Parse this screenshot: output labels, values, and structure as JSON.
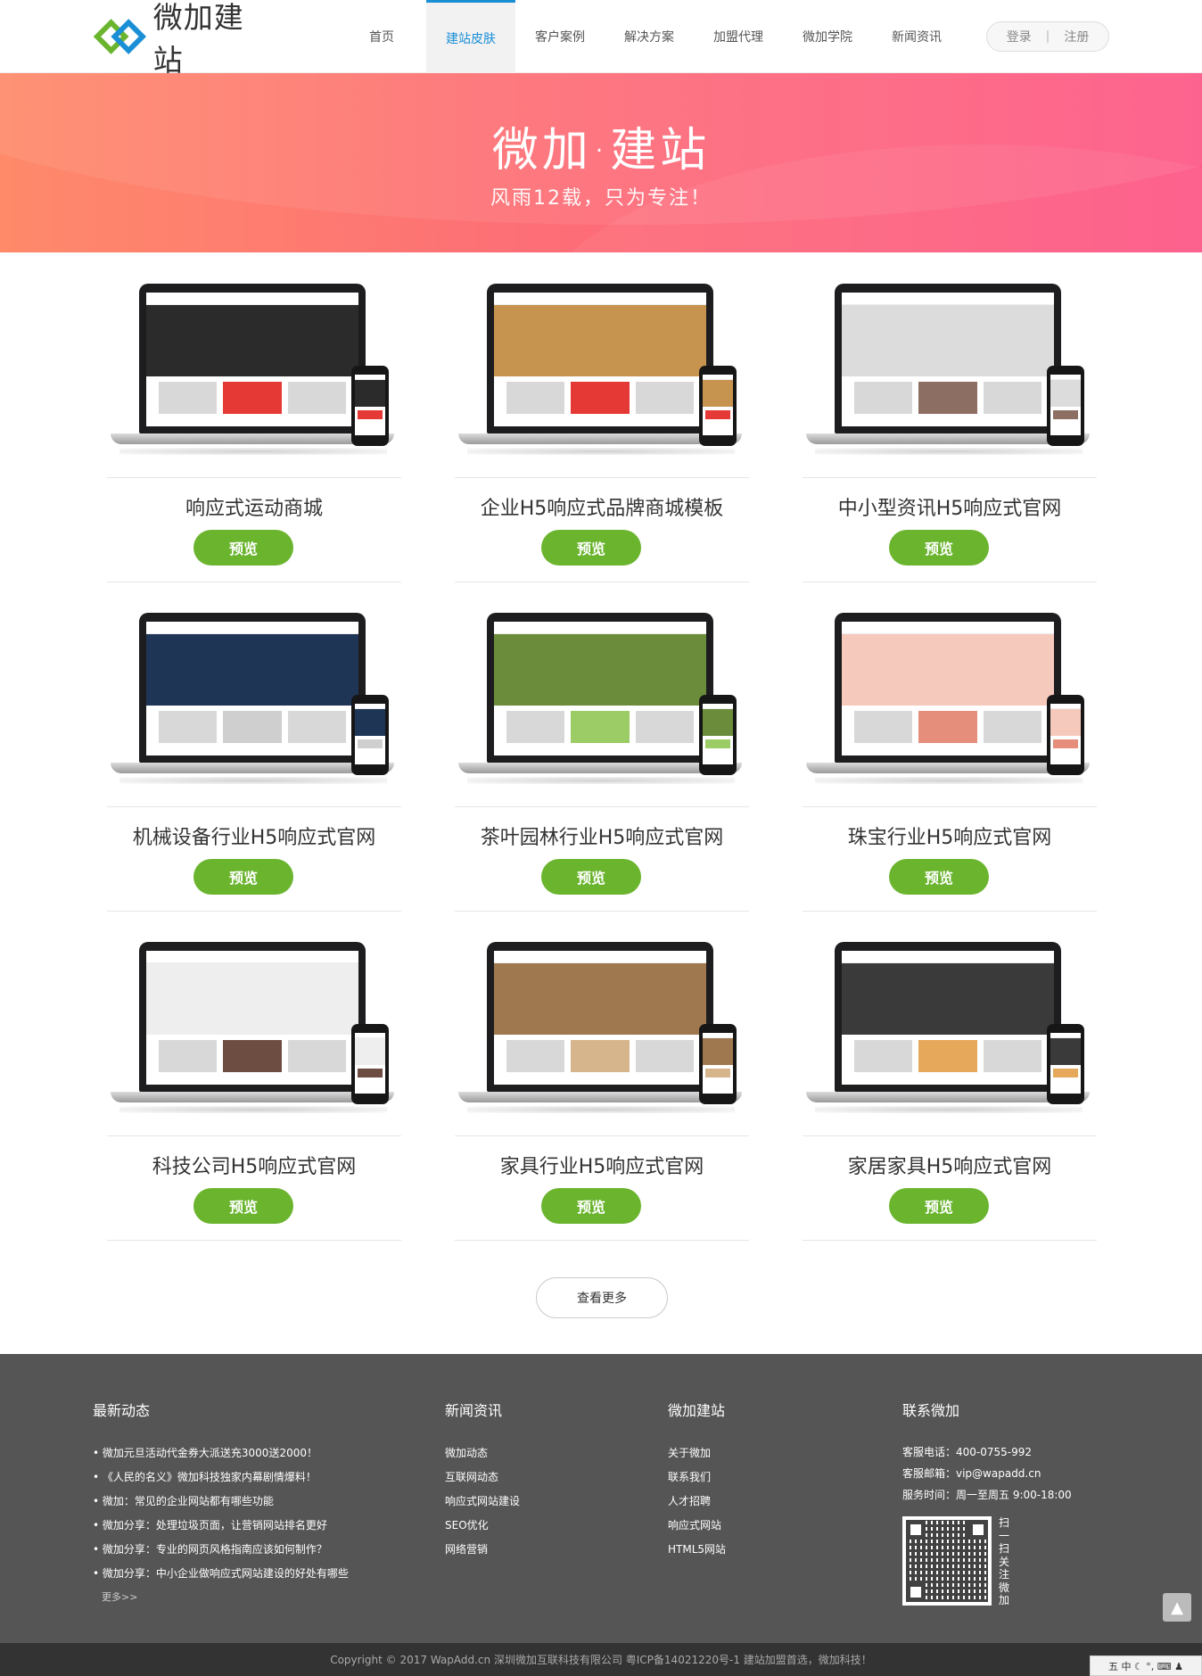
{
  "header": {
    "logo_text": "微加建站",
    "nav": [
      {
        "label": "首页"
      },
      {
        "label": "建站皮肤",
        "active": true
      },
      {
        "label": "客户案例"
      },
      {
        "label": "解决方案"
      },
      {
        "label": "加盟代理"
      },
      {
        "label": "微加学院"
      },
      {
        "label": "新闻资讯"
      }
    ],
    "login": "登录",
    "separator": "|",
    "register": "注册"
  },
  "banner": {
    "title": "微加·建站",
    "subtitle": "风雨12载，只为专注！"
  },
  "templates": [
    {
      "title": "响应式运动商城",
      "button": "预览",
      "theme": "#2b2b2b",
      "accent": "#e53935"
    },
    {
      "title": "企业H5响应式品牌商城模板",
      "button": "预览",
      "theme": "#c79450",
      "accent": "#e53935"
    },
    {
      "title": "中小型资讯H5响应式官网",
      "button": "预览",
      "theme": "#dcdcdc",
      "accent": "#8d6e63"
    },
    {
      "title": "机械设备行业H5响应式官网",
      "button": "预览",
      "theme": "#1f3556",
      "accent": "#cfcfcf"
    },
    {
      "title": "茶叶园林行业H5响应式官网",
      "button": "预览",
      "theme": "#6b8c3a",
      "accent": "#9ccc65"
    },
    {
      "title": "珠宝行业H5响应式官网",
      "button": "预览",
      "theme": "#f6c9bd",
      "accent": "#e58e7c"
    },
    {
      "title": "科技公司H5响应式官网",
      "button": "预览",
      "theme": "#eeeeee",
      "accent": "#6d4c41"
    },
    {
      "title": "家具行业H5响应式官网",
      "button": "预览",
      "theme": "#a07850",
      "accent": "#d7b58c"
    },
    {
      "title": "家居家具H5响应式官网",
      "button": "预览",
      "theme": "#3a3a3a",
      "accent": "#e6a85a"
    }
  ],
  "more_button": "查看更多",
  "footer": {
    "news": {
      "heading": "最新动态",
      "items": [
        "微加元旦活动代金券大派送充3000送2000！",
        "《人民的名义》微加科技独家内幕剧情爆料！",
        "微加：常见的企业网站都有哪些功能",
        "微加分享：处理垃圾页面，让营销网站排名更好",
        "微加分享：专业的网页风格指南应该如何制作？",
        "微加分享：中小企业做响应式网站建设的好处有哪些"
      ],
      "more": "更多>>"
    },
    "info": {
      "heading": "新闻资讯",
      "items": [
        "微加动态",
        "互联网动态",
        "响应式网站建设",
        "SEO优化",
        "网络营销"
      ]
    },
    "site": {
      "heading": "微加建站",
      "items": [
        "关于微加",
        "联系我们",
        "人才招聘",
        "响应式网站",
        "HTML5网站"
      ]
    },
    "contact": {
      "heading": "联系微加",
      "phone": "客服电话：400-0755-992",
      "email": "客服邮箱：vip@wapadd.cn",
      "hours": "服务时间：周一至周五 9:00-18:00",
      "qr_caption": "扫一扫关注微加"
    }
  },
  "copyright": "Copyright © 2017 WapAdd.cn 深圳微加互联科技有限公司 粤ICP备14021220号-1 建站加盟首选，微加科技！",
  "ime_bar": "五 中 ☾ °, ⌨ ♟"
}
